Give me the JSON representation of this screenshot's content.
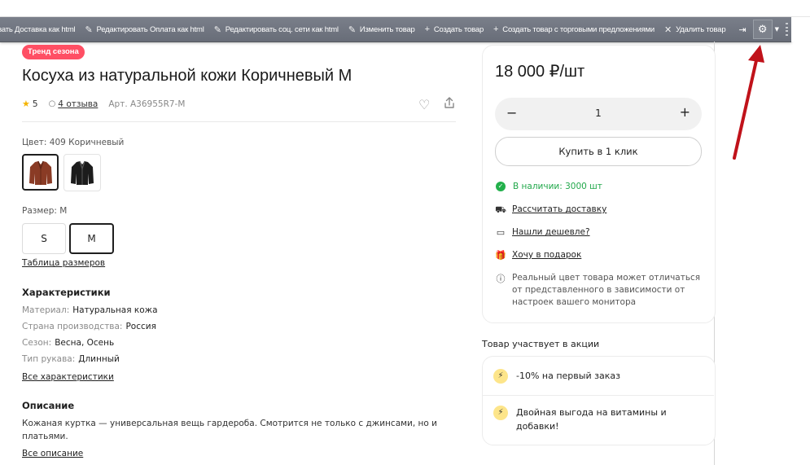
{
  "toolbar": {
    "items": [
      {
        "label": "овать Доставка как html",
        "icon": "pencil-icon"
      },
      {
        "label": "Редактировать Оплата как html",
        "icon": "pencil-icon"
      },
      {
        "label": "Редактировать соц. сети как html",
        "icon": "pencil-icon"
      },
      {
        "label": "Изменить товар",
        "icon": "pencil-icon"
      },
      {
        "label": "Создать товар",
        "icon": "plus-icon"
      },
      {
        "label": "Создать товар с торговыми предложениями",
        "icon": "plus-icon"
      },
      {
        "label": "Удалить товар",
        "icon": "close-icon"
      }
    ]
  },
  "product": {
    "badge": "Тренд сезона",
    "title": "Косуха из натуральной кожи Коричневый M",
    "rating": "5",
    "reviews": "4 отзыва",
    "article": "Арт. А36955R7-M",
    "color_label": "Цвет: 409 Коричневый",
    "size_label": "Размер: M",
    "sizes": [
      "S",
      "M"
    ],
    "size_table_link": "Таблица размеров"
  },
  "characteristics": {
    "heading": "Характеристики",
    "rows": [
      {
        "key": "Материал:",
        "value": "Натуральная кожа"
      },
      {
        "key": "Страна производства:",
        "value": "Россия"
      },
      {
        "key": "Сезон:",
        "value": "Весна, Осень"
      },
      {
        "key": "Тип рукава:",
        "value": "Длинный"
      }
    ],
    "all_link": "Все характеристики"
  },
  "description": {
    "heading": "Описание",
    "text": "Кожаная куртка — универсальная вещь гардероба. Смотрится не только с джинсами, но и платьями.",
    "all_link": "Все описание"
  },
  "buy": {
    "price": "18 000 ₽/шт",
    "quantity": "1",
    "minus": "−",
    "plus": "+",
    "one_click": "Купить в 1 клик",
    "in_stock": "В наличии: 3000 шт",
    "delivery": "Рассчитать доставку",
    "cheaper": "Нашли дешевле?",
    "gift": "Хочу в подарок",
    "note": "Реальный цвет товара может отличаться от представленного в зависимости от настроек вашего монитора"
  },
  "promo": {
    "heading": "Товар участвует в акции",
    "items": [
      "-10% на первый заказ",
      "Двойная выгода на витамины и добавки!"
    ]
  },
  "colors": {
    "badge_bg": "#ff4f64",
    "in_stock": "#22a84b",
    "toolbar_bg": "#6b7280",
    "arrow": "#c0121a"
  }
}
